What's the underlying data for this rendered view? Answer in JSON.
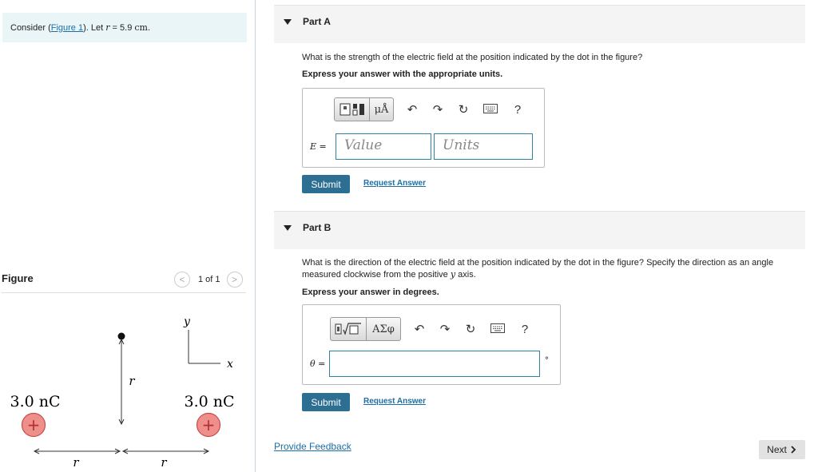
{
  "intro": {
    "prefix": "Consider (",
    "link": "Figure 1",
    "suffix": "). Let ",
    "var": "r",
    "eq": " = 5.9 ",
    "unit": "cm",
    "end": "."
  },
  "figure": {
    "title": "Figure",
    "pager": {
      "prev": "<",
      "count": "1 of 1",
      "next": ">"
    },
    "left_charge": "3.0 nC",
    "right_charge": "3.0 nC",
    "plus": "+",
    "r_label": "r",
    "y_axis": "y",
    "x_axis": "x"
  },
  "partA": {
    "label": "Part A",
    "question": "What is the strength of the electric field at the position indicated by the dot in the figure?",
    "instruction": "Express your answer with the appropriate units.",
    "toolbar": {
      "units_btn": "μÅ",
      "help": "?"
    },
    "eq_var": "E",
    "eq_sign": " =",
    "value_placeholder": "Value",
    "units_placeholder": "Units",
    "submit": "Submit",
    "request": "Request Answer"
  },
  "partB": {
    "label": "Part B",
    "question_1": "What is the direction of the electric field at the position indicated by the dot in the figure? Specify the direction as an angle",
    "question_2a": "measured clockwise from the positive ",
    "question_2var": "y",
    "question_2b": " axis.",
    "instruction": "Express your answer in degrees.",
    "toolbar": {
      "greek_btn": "ΑΣφ",
      "help": "?"
    },
    "eq_var": "θ",
    "eq_sign": " =",
    "degree": "°",
    "submit": "Submit",
    "request": "Request Answer"
  },
  "footer": {
    "feedback": "Provide Feedback",
    "next": "Next"
  }
}
